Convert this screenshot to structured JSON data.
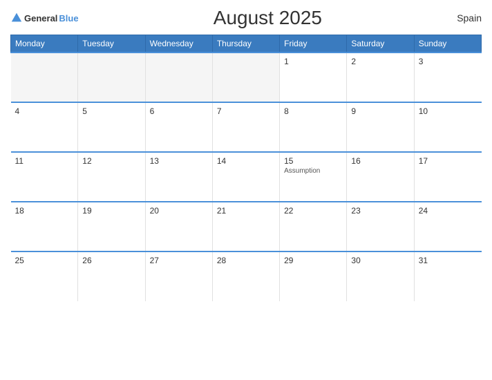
{
  "header": {
    "logo_general": "General",
    "logo_blue": "Blue",
    "title": "August 2025",
    "country": "Spain"
  },
  "weekdays": [
    "Monday",
    "Tuesday",
    "Wednesday",
    "Thursday",
    "Friday",
    "Saturday",
    "Sunday"
  ],
  "weeks": [
    [
      {
        "day": "",
        "empty": true
      },
      {
        "day": "",
        "empty": true
      },
      {
        "day": "",
        "empty": true
      },
      {
        "day": "",
        "empty": true
      },
      {
        "day": "1",
        "event": ""
      },
      {
        "day": "2",
        "event": ""
      },
      {
        "day": "3",
        "event": ""
      }
    ],
    [
      {
        "day": "4",
        "event": ""
      },
      {
        "day": "5",
        "event": ""
      },
      {
        "day": "6",
        "event": ""
      },
      {
        "day": "7",
        "event": ""
      },
      {
        "day": "8",
        "event": ""
      },
      {
        "day": "9",
        "event": ""
      },
      {
        "day": "10",
        "event": ""
      }
    ],
    [
      {
        "day": "11",
        "event": ""
      },
      {
        "day": "12",
        "event": ""
      },
      {
        "day": "13",
        "event": ""
      },
      {
        "day": "14",
        "event": ""
      },
      {
        "day": "15",
        "event": "Assumption"
      },
      {
        "day": "16",
        "event": ""
      },
      {
        "day": "17",
        "event": ""
      }
    ],
    [
      {
        "day": "18",
        "event": ""
      },
      {
        "day": "19",
        "event": ""
      },
      {
        "day": "20",
        "event": ""
      },
      {
        "day": "21",
        "event": ""
      },
      {
        "day": "22",
        "event": ""
      },
      {
        "day": "23",
        "event": ""
      },
      {
        "day": "24",
        "event": ""
      }
    ],
    [
      {
        "day": "25",
        "event": ""
      },
      {
        "day": "26",
        "event": ""
      },
      {
        "day": "27",
        "event": ""
      },
      {
        "day": "28",
        "event": ""
      },
      {
        "day": "29",
        "event": ""
      },
      {
        "day": "30",
        "event": ""
      },
      {
        "day": "31",
        "event": ""
      }
    ]
  ]
}
